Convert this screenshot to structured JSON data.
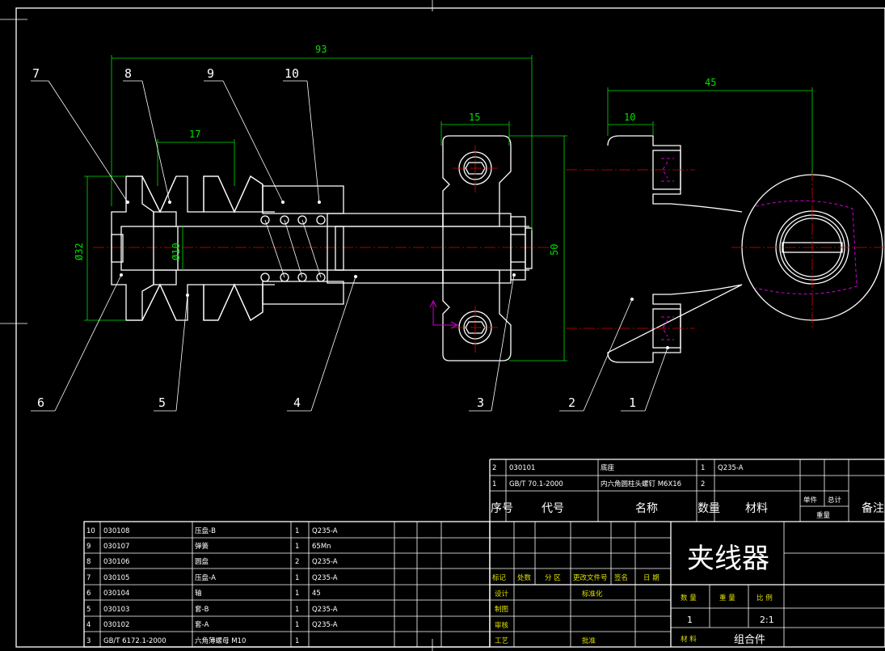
{
  "balloons": [
    "1",
    "2",
    "3",
    "4",
    "5",
    "6",
    "7",
    "8",
    "9",
    "10"
  ],
  "dimensions": {
    "d93": "93",
    "d17": "17",
    "d15": "15",
    "d45": "45",
    "d10": "10",
    "d50": "50",
    "dia32": "Ø32",
    "dia10": "Ø10"
  },
  "bom_upper": [
    {
      "no": "2",
      "code": "030101",
      "name": "底座",
      "qty": "1",
      "material": "Q235-A"
    },
    {
      "no": "1",
      "code": "GB/T 70.1-2000",
      "name": "内六角圆柱头螺钉 M6X16",
      "qty": "2",
      "material": ""
    }
  ],
  "bom_header": {
    "no": "序号",
    "code": "代号",
    "name": "名称",
    "qty": "数量",
    "material": "材料",
    "single": "单件",
    "total": "总计",
    "weight": "重量",
    "remark": "备注"
  },
  "bom_lower": [
    {
      "no": "10",
      "code": "030108",
      "name": "压盘-B",
      "qty": "1",
      "material": "Q235-A"
    },
    {
      "no": "9",
      "code": "030107",
      "name": "弹簧",
      "qty": "1",
      "material": "65Mn"
    },
    {
      "no": "8",
      "code": "030106",
      "name": "圆盘",
      "qty": "2",
      "material": "Q235-A"
    },
    {
      "no": "7",
      "code": "030105",
      "name": "压盘-A",
      "qty": "1",
      "material": "Q235-A"
    },
    {
      "no": "6",
      "code": "030104",
      "name": "轴",
      "qty": "1",
      "material": "45"
    },
    {
      "no": "5",
      "code": "030103",
      "name": "套-B",
      "qty": "1",
      "material": "Q235-A"
    },
    {
      "no": "4",
      "code": "030102",
      "name": "套-A",
      "qty": "1",
      "material": "Q235-A"
    },
    {
      "no": "3",
      "code": "GB/T 6172.1-2000",
      "name": "六角薄螺母 M10",
      "qty": "1",
      "material": ""
    }
  ],
  "title_block": {
    "title": "夹线器",
    "mark": "标记",
    "count": "处数",
    "zone": "分 区",
    "doc": "更改文件号",
    "sign": "签名",
    "date": "日 期",
    "design": "设计",
    "standard": "标准化",
    "draw": "制图",
    "review": "审核",
    "process": "工艺",
    "approve": "批准",
    "qty_label": "数 量",
    "weight_label": "重 量",
    "scale_label": "比 例",
    "qty_value": "1",
    "scale_value": "2:1",
    "material_label": "材 料",
    "material_value": "组合件"
  },
  "colors": {
    "background": "#000000",
    "outline": "#ffffff",
    "dimension": "#00e000",
    "centerline": "#e00000",
    "hidden": "#d000d0",
    "hatch": "#00b0b0",
    "label_yellow": "#e0e000"
  }
}
